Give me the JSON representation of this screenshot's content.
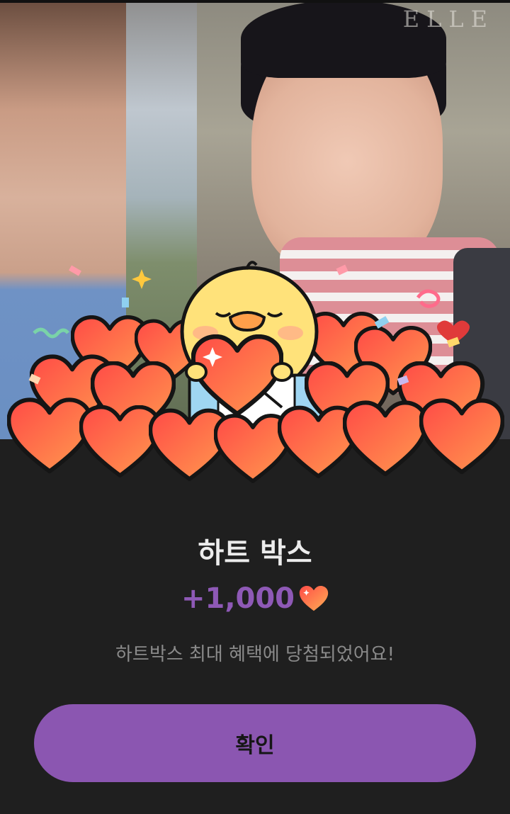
{
  "popup": {
    "title": "하트 박스",
    "amount": "+1,000",
    "currency_icon": "heart-icon",
    "description": "하트박스 최대 혜택에 당첨되었어요!",
    "confirm_label": "확인"
  },
  "video": {
    "watermark": "ELLE"
  },
  "colors": {
    "accent": "#8b56b1",
    "amount_text": "#8e59b6",
    "heart": "#ff5a4a",
    "sheet_bg": "#1f1f1f"
  }
}
